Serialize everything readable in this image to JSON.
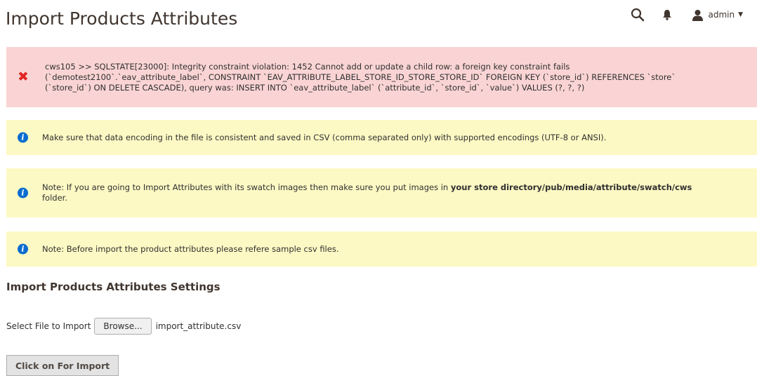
{
  "page": {
    "title": "Import Products Attributes"
  },
  "header": {
    "search_icon": "search-icon",
    "notifications_icon": "bell-icon",
    "user_icon": "user-icon",
    "user_name": "admin"
  },
  "messages": {
    "error": {
      "icon": "error-x-icon",
      "line1": "cws105 >> SQLSTATE[23000]: Integrity constraint violation: 1452 Cannot add or update a child row: a foreign key constraint fails",
      "line2": "(`demotest2100`.`eav_attribute_label`, CONSTRAINT `EAV_ATTRIBUTE_LABEL_STORE_ID_STORE_STORE_ID` FOREIGN KEY (`store_id`) REFERENCES `store`",
      "line3": "(`store_id`) ON DELETE CASCADE), query was: INSERT INTO `eav_attribute_label` (`attribute_id`, `store_id`, `value`) VALUES (?, ?, ?)"
    },
    "info1": {
      "icon": "info-icon",
      "text": "Make sure that data encoding in the file is consistent and saved in CSV (comma separated only) with supported encodings (UTF-8 or ANSI)."
    },
    "info2": {
      "icon": "info-icon",
      "text_before": "Note: If you are going to Import Attributes with its swatch images then make sure you put images in ",
      "text_bold": "your store directory/pub/media/attribute/swatch/cws",
      "text_after": "folder."
    },
    "info3": {
      "icon": "info-icon",
      "text": "Note: Before import the product attributes please refere sample csv files."
    }
  },
  "settings": {
    "title": "Import Products Attributes Settings",
    "file_label": "Select File to Import",
    "browse_label": "Browse...",
    "file_name": "import_attribute.csv",
    "import_button": "Click on For Import"
  },
  "colors": {
    "error_bg": "#fad4d4",
    "info_bg": "#fdf9c4",
    "error_icon": "#e22626",
    "info_icon": "#0a6ccf"
  }
}
